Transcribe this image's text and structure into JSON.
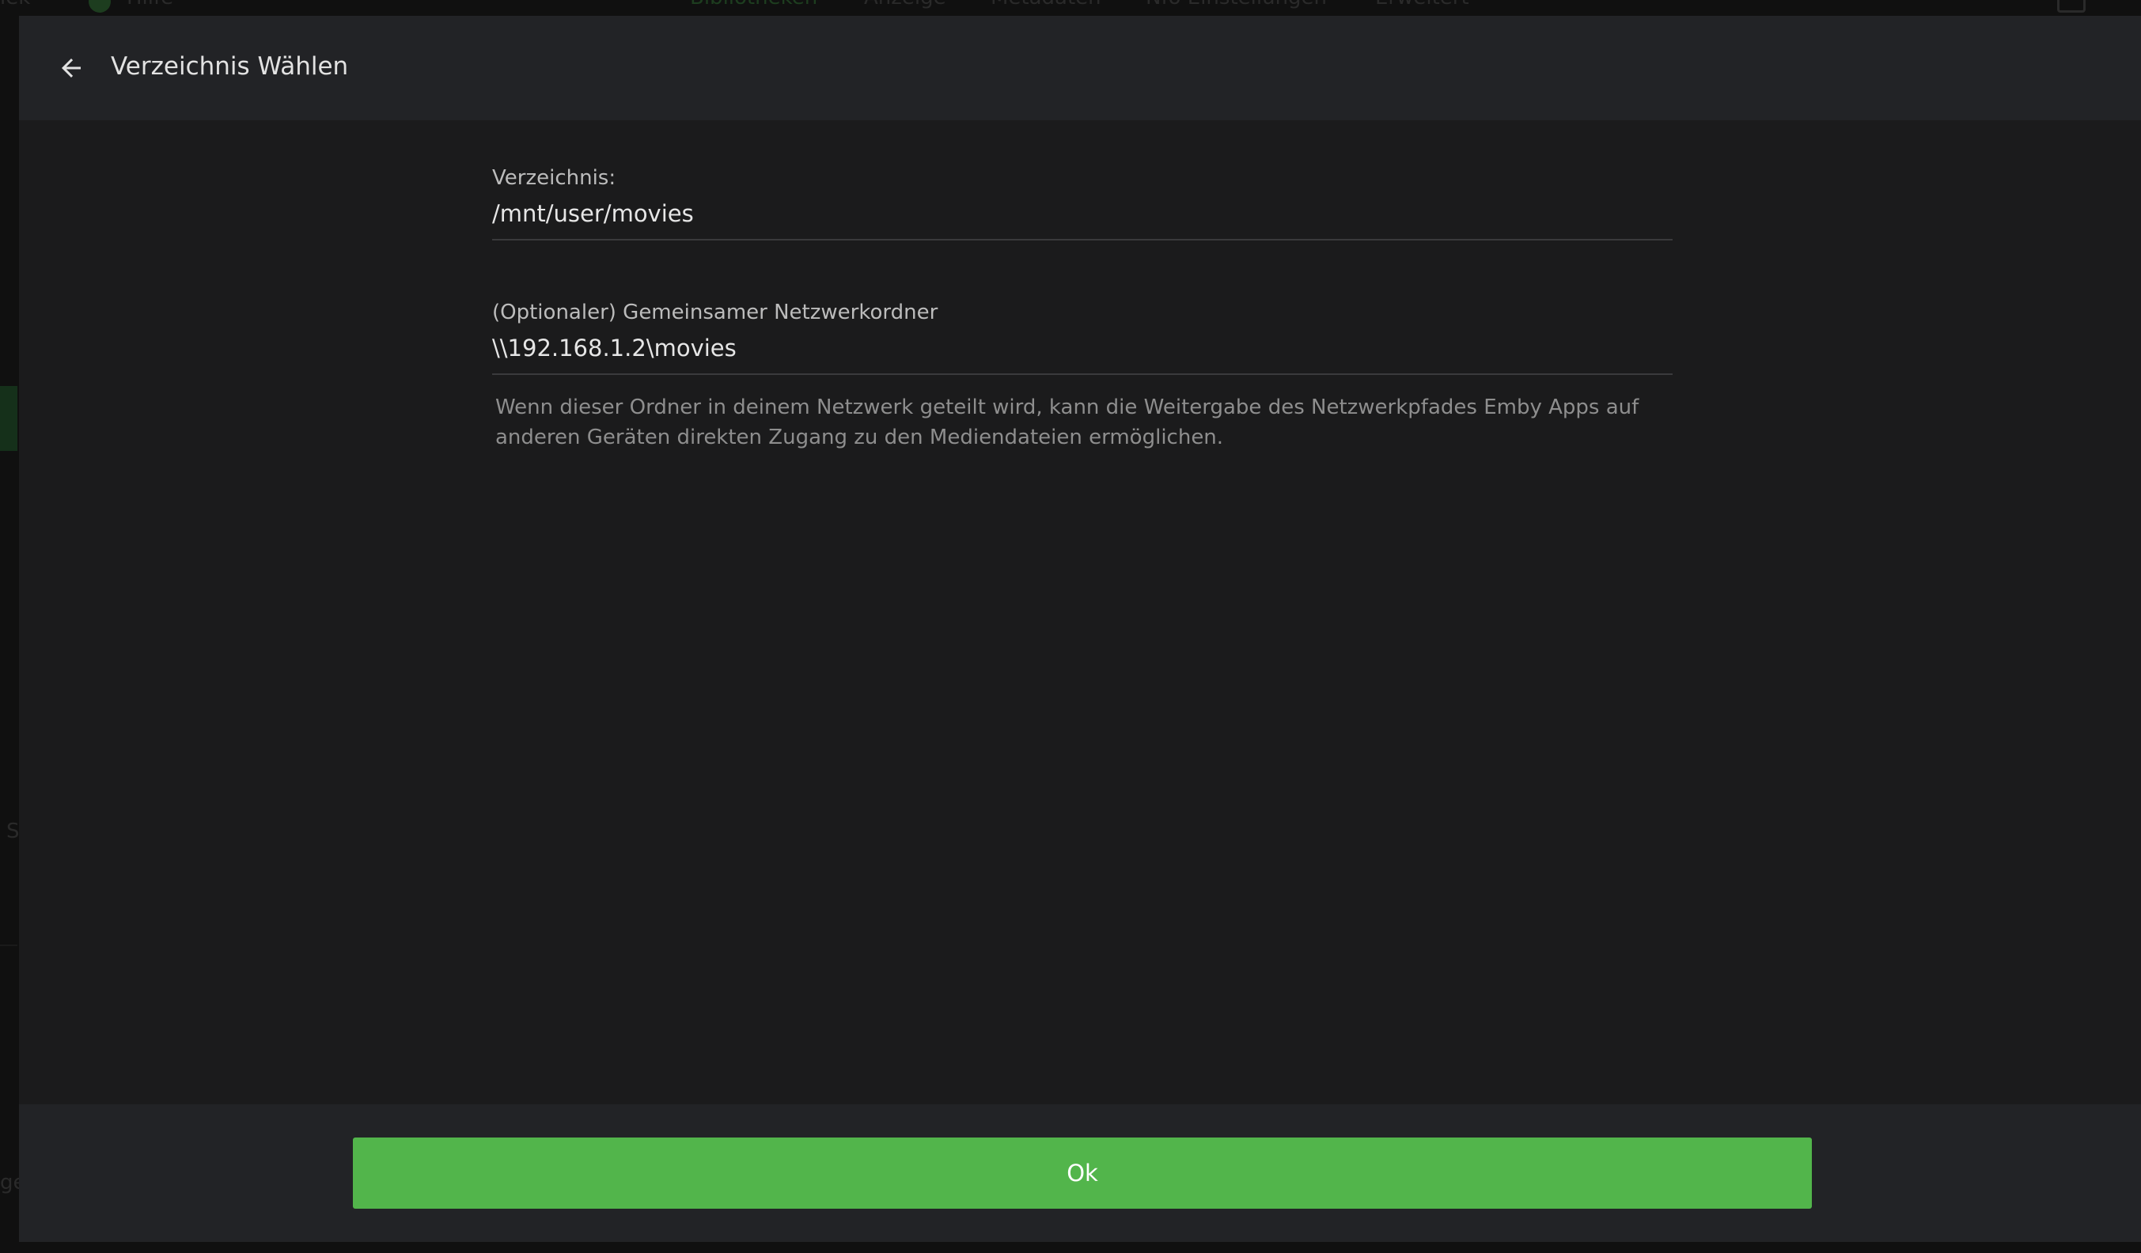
{
  "background": {
    "nav_left_fragment": "iek",
    "help_label": "Hilfe",
    "tabs": [
      {
        "label": "Bibliotheken",
        "active": true
      },
      {
        "label": "Anzeige",
        "active": false
      },
      {
        "label": "Metadaten",
        "active": false
      },
      {
        "label": "Nfo Einstellungen",
        "active": false
      },
      {
        "label": "Erweitert",
        "active": false
      }
    ],
    "left_fragment_s": "S",
    "left_fragment_ge": "ge"
  },
  "dialog": {
    "back_icon": "arrow-left-icon",
    "title": "Verzeichnis Wählen",
    "directory": {
      "label": "Verzeichnis:",
      "value": "/mnt/user/movies"
    },
    "network_share": {
      "label": "(Optionaler) Gemeinsamer Netzwerkordner",
      "value": "\\\\192.168.1.2\\movies",
      "help": "Wenn dieser Ordner in deinem Netzwerk geteilt wird, kann die Weitergabe des Netzwerkpfades Emby Apps auf anderen Geräten direkten Zugang zu den Mediendateien ermöglichen."
    },
    "ok_label": "Ok"
  },
  "colors": {
    "accent": "#52b54b",
    "header_bg": "#222326",
    "dialog_bg": "#1b1b1c"
  }
}
